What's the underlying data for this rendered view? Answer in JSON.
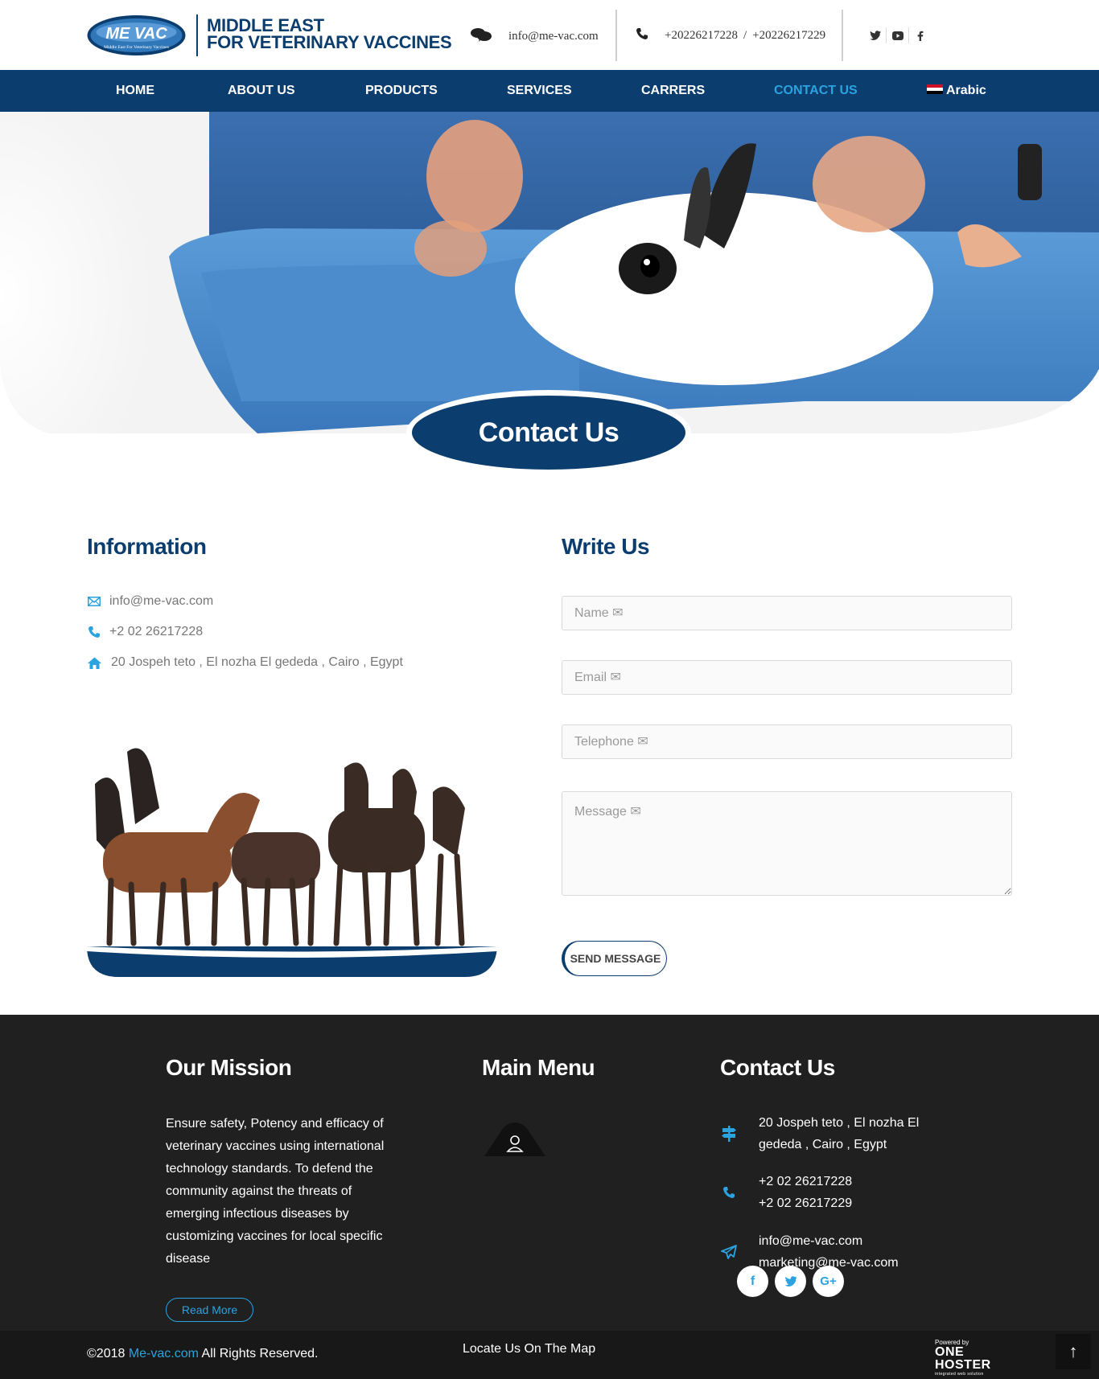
{
  "header": {
    "brand_line1": "MIDDLE EAST",
    "brand_line2": "FOR VETERINARY VACCINES",
    "logo_text": "ME VAC",
    "logo_subtext": "Middle East For Veterinary Vaccines",
    "email": "info@me-vac.com",
    "phone1": "+20226217228",
    "phone_separator": "/",
    "phone2": "+20226217229",
    "social_icons": [
      "twitter-icon",
      "youtube-icon",
      "facebook-icon"
    ]
  },
  "nav": {
    "items": [
      {
        "label": "HOME"
      },
      {
        "label": "ABOUT US"
      },
      {
        "label": "PRODUCTS"
      },
      {
        "label": "SERVICES"
      },
      {
        "label": "CARRERS"
      },
      {
        "label": "CONTACT US"
      },
      {
        "label": "Arabic"
      }
    ],
    "active": "CONTACT US"
  },
  "hero": {
    "title": "Contact Us"
  },
  "information": {
    "title": "Information",
    "email": "info@me-vac.com",
    "phone": "+2 02 26217228",
    "address": "20 Jospeh teto , El nozha El gededa , Cairo , Egypt"
  },
  "form": {
    "title": "Write Us",
    "name_placeholder": "Name ✉",
    "email_placeholder": "Email ✉",
    "telephone_placeholder": "Telephone ✉",
    "message_placeholder": "Message ✉",
    "send_label": "SEND MESSAGE"
  },
  "footer": {
    "mission_title": "Our Mission",
    "mission_text": "Ensure safety, Potency and efficacy of veterinary vaccines using international technology standards. To defend the community against the threats of emerging infectious diseases by customizing vaccines for local specific disease",
    "read_more": "Read More",
    "menu_title": "Main Menu",
    "contact_title": "Contact Us",
    "address_line1": "20 Jospeh teto , El nozha El",
    "address_line2": "gededa , Cairo , Egypt",
    "phone1": "+2 02 26217228",
    "phone2": "+2 02 26217229",
    "email1": "info@me-vac.com",
    "email2": "marketing@me-vac.com",
    "social": [
      "f",
      "t",
      "G+"
    ]
  },
  "bottom": {
    "copyright_prefix": "©2018 ",
    "copyright_link": "Me-vac.com",
    "copyright_suffix": " All Rights Reserved.",
    "locate": "Locate Us On The Map",
    "powered_by": "Powered by",
    "hoster_name": "ONE HOSTER",
    "hoster_tagline": "integrated web solution",
    "to_top": "↑"
  },
  "colors": {
    "brand_navy": "#0b3d6e",
    "accent_blue": "#2aa3e0",
    "footer_bg": "#202020"
  }
}
